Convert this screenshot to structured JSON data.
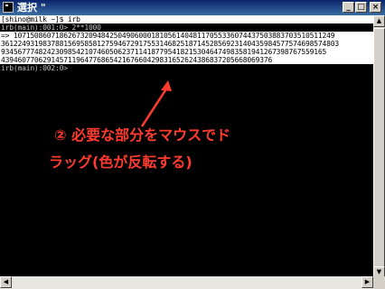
{
  "window": {
    "title": "選択 \"",
    "buttons": {
      "minimize": "_",
      "maximize": "□",
      "close": "×"
    }
  },
  "console": {
    "lines": [
      "[shino@milk ~]$ irb",
      "irb(main):001:0> 2**1000",
      "=> 10715086071862673209484250490600018105614048117055336074437503883703510511249",
      "361224931983788156958581275946729175531468251871452856923140435984577574698574803",
      "934567774824230985421074605062371141877954182153046474983581941267398767559165",
      "43946077062914571196477686542167660429831652624386837205668069376",
      "irb(main):002:0>"
    ]
  },
  "annotation": {
    "line1": "② 必要な部分をマウスでド",
    "line2": "ラッグ(色が反転する)",
    "color": "#ff3b2f"
  },
  "scrollbars": {
    "up": "▲",
    "down": "▼",
    "left": "◀",
    "right": "▶"
  }
}
